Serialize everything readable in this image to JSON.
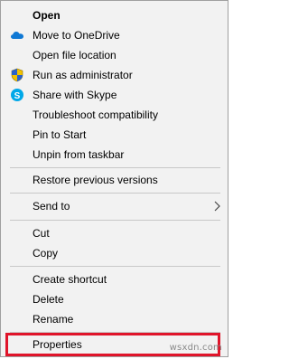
{
  "menu": {
    "open": "Open",
    "move_to_onedrive": "Move to OneDrive",
    "open_file_location": "Open file location",
    "run_as_admin": "Run as administrator",
    "share_with_skype": "Share with Skype",
    "troubleshoot": "Troubleshoot compatibility",
    "pin_to_start": "Pin to Start",
    "unpin_from_taskbar": "Unpin from taskbar",
    "restore_previous": "Restore previous versions",
    "send_to": "Send to",
    "cut": "Cut",
    "copy": "Copy",
    "create_shortcut": "Create shortcut",
    "delete": "Delete",
    "rename": "Rename",
    "properties": "Properties"
  },
  "icons": {
    "onedrive": "onedrive-cloud-icon",
    "shield": "uac-shield-icon",
    "skype": "skype-icon",
    "submenu": "chevron-right-icon"
  },
  "colors": {
    "highlight_border": "#e0142a",
    "onedrive_blue": "#0f78d4",
    "skype_blue": "#00a8e8"
  },
  "watermark": "wsxdn.com"
}
